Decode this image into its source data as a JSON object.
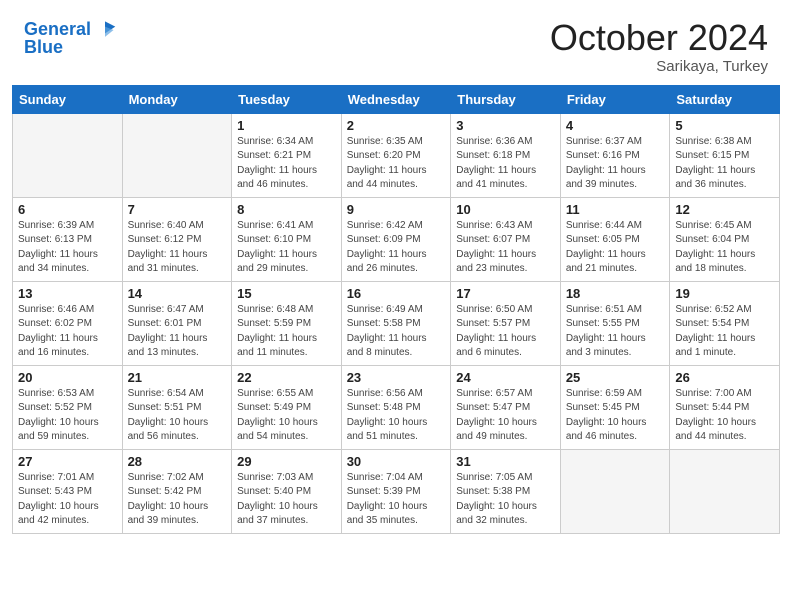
{
  "header": {
    "logo_line1": "General",
    "logo_line2": "Blue",
    "month": "October 2024",
    "location": "Sarikaya, Turkey"
  },
  "weekdays": [
    "Sunday",
    "Monday",
    "Tuesday",
    "Wednesday",
    "Thursday",
    "Friday",
    "Saturday"
  ],
  "weeks": [
    [
      {
        "day": "",
        "info": ""
      },
      {
        "day": "",
        "info": ""
      },
      {
        "day": "1",
        "info": "Sunrise: 6:34 AM\nSunset: 6:21 PM\nDaylight: 11 hours and 46 minutes."
      },
      {
        "day": "2",
        "info": "Sunrise: 6:35 AM\nSunset: 6:20 PM\nDaylight: 11 hours and 44 minutes."
      },
      {
        "day": "3",
        "info": "Sunrise: 6:36 AM\nSunset: 6:18 PM\nDaylight: 11 hours and 41 minutes."
      },
      {
        "day": "4",
        "info": "Sunrise: 6:37 AM\nSunset: 6:16 PM\nDaylight: 11 hours and 39 minutes."
      },
      {
        "day": "5",
        "info": "Sunrise: 6:38 AM\nSunset: 6:15 PM\nDaylight: 11 hours and 36 minutes."
      }
    ],
    [
      {
        "day": "6",
        "info": "Sunrise: 6:39 AM\nSunset: 6:13 PM\nDaylight: 11 hours and 34 minutes."
      },
      {
        "day": "7",
        "info": "Sunrise: 6:40 AM\nSunset: 6:12 PM\nDaylight: 11 hours and 31 minutes."
      },
      {
        "day": "8",
        "info": "Sunrise: 6:41 AM\nSunset: 6:10 PM\nDaylight: 11 hours and 29 minutes."
      },
      {
        "day": "9",
        "info": "Sunrise: 6:42 AM\nSunset: 6:09 PM\nDaylight: 11 hours and 26 minutes."
      },
      {
        "day": "10",
        "info": "Sunrise: 6:43 AM\nSunset: 6:07 PM\nDaylight: 11 hours and 23 minutes."
      },
      {
        "day": "11",
        "info": "Sunrise: 6:44 AM\nSunset: 6:05 PM\nDaylight: 11 hours and 21 minutes."
      },
      {
        "day": "12",
        "info": "Sunrise: 6:45 AM\nSunset: 6:04 PM\nDaylight: 11 hours and 18 minutes."
      }
    ],
    [
      {
        "day": "13",
        "info": "Sunrise: 6:46 AM\nSunset: 6:02 PM\nDaylight: 11 hours and 16 minutes."
      },
      {
        "day": "14",
        "info": "Sunrise: 6:47 AM\nSunset: 6:01 PM\nDaylight: 11 hours and 13 minutes."
      },
      {
        "day": "15",
        "info": "Sunrise: 6:48 AM\nSunset: 5:59 PM\nDaylight: 11 hours and 11 minutes."
      },
      {
        "day": "16",
        "info": "Sunrise: 6:49 AM\nSunset: 5:58 PM\nDaylight: 11 hours and 8 minutes."
      },
      {
        "day": "17",
        "info": "Sunrise: 6:50 AM\nSunset: 5:57 PM\nDaylight: 11 hours and 6 minutes."
      },
      {
        "day": "18",
        "info": "Sunrise: 6:51 AM\nSunset: 5:55 PM\nDaylight: 11 hours and 3 minutes."
      },
      {
        "day": "19",
        "info": "Sunrise: 6:52 AM\nSunset: 5:54 PM\nDaylight: 11 hours and 1 minute."
      }
    ],
    [
      {
        "day": "20",
        "info": "Sunrise: 6:53 AM\nSunset: 5:52 PM\nDaylight: 10 hours and 59 minutes."
      },
      {
        "day": "21",
        "info": "Sunrise: 6:54 AM\nSunset: 5:51 PM\nDaylight: 10 hours and 56 minutes."
      },
      {
        "day": "22",
        "info": "Sunrise: 6:55 AM\nSunset: 5:49 PM\nDaylight: 10 hours and 54 minutes."
      },
      {
        "day": "23",
        "info": "Sunrise: 6:56 AM\nSunset: 5:48 PM\nDaylight: 10 hours and 51 minutes."
      },
      {
        "day": "24",
        "info": "Sunrise: 6:57 AM\nSunset: 5:47 PM\nDaylight: 10 hours and 49 minutes."
      },
      {
        "day": "25",
        "info": "Sunrise: 6:59 AM\nSunset: 5:45 PM\nDaylight: 10 hours and 46 minutes."
      },
      {
        "day": "26",
        "info": "Sunrise: 7:00 AM\nSunset: 5:44 PM\nDaylight: 10 hours and 44 minutes."
      }
    ],
    [
      {
        "day": "27",
        "info": "Sunrise: 7:01 AM\nSunset: 5:43 PM\nDaylight: 10 hours and 42 minutes."
      },
      {
        "day": "28",
        "info": "Sunrise: 7:02 AM\nSunset: 5:42 PM\nDaylight: 10 hours and 39 minutes."
      },
      {
        "day": "29",
        "info": "Sunrise: 7:03 AM\nSunset: 5:40 PM\nDaylight: 10 hours and 37 minutes."
      },
      {
        "day": "30",
        "info": "Sunrise: 7:04 AM\nSunset: 5:39 PM\nDaylight: 10 hours and 35 minutes."
      },
      {
        "day": "31",
        "info": "Sunrise: 7:05 AM\nSunset: 5:38 PM\nDaylight: 10 hours and 32 minutes."
      },
      {
        "day": "",
        "info": ""
      },
      {
        "day": "",
        "info": ""
      }
    ]
  ]
}
